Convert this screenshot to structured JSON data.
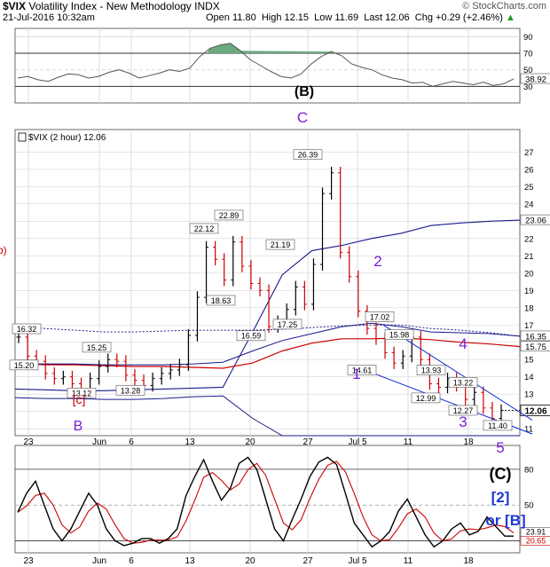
{
  "header": {
    "symbol": "$VIX",
    "name": "Volatility Index - New Methodology  INDX",
    "datetime": "21-Jul-2016 10:32am",
    "open_label": "Open",
    "open": "11.80",
    "high_label": "High",
    "high": "12.15",
    "low_label": "Low",
    "low": "11.69",
    "last_label": "Last",
    "last": "12.06",
    "chg_label": "Chg",
    "chg": "+0.29 (+2.46%)",
    "chg_arrow": "▲",
    "watermark": "© StockCharts.com"
  },
  "colors": {
    "price_up": "#000000",
    "price_down": "#cc0000",
    "bollinger": "#1a1a8c",
    "ma_red": "#cc0000",
    "ma_dotted": "#1a1a8c",
    "wave_purple": "#7a1fd6",
    "wave_red": "#cc0000",
    "wave_blue": "#1f38d6",
    "rsi_fill": "#6aaa7e",
    "grid": "#d6d6d6"
  },
  "chart_data": [
    {
      "type": "line",
      "panel": "RSI",
      "ylim": [
        10,
        100
      ],
      "yticks": [
        30,
        50,
        70,
        90
      ],
      "overbought": 70,
      "oversold": 30,
      "last_value": "38.92",
      "annotation": "(B)",
      "values": [
        40,
        42,
        38,
        36,
        41,
        45,
        44,
        40,
        42,
        47,
        50,
        46,
        40,
        43,
        46,
        50,
        48,
        52,
        66,
        76,
        80,
        82,
        73,
        62,
        55,
        48,
        42,
        40,
        45,
        57,
        66,
        72,
        67,
        57,
        53,
        50,
        44,
        40,
        38,
        34,
        35,
        30,
        33,
        36,
        34,
        32,
        35,
        31,
        33,
        39
      ]
    },
    {
      "type": "line",
      "panel": "price",
      "legend": "$VIX (2 hour) 12.06",
      "last_value": "12.06",
      "ylim": [
        10.6,
        28.3
      ],
      "yticks": [
        11,
        12,
        13,
        14,
        15,
        16,
        17,
        18,
        19,
        20,
        21,
        22,
        23,
        24,
        25,
        26,
        27
      ],
      "xlabels": [
        "23",
        "Jun",
        "6",
        "13",
        "20",
        "27",
        "Jul 5",
        "11",
        "18"
      ],
      "closes": [
        16.3,
        15.2,
        14.9,
        14.2,
        13.9,
        14.0,
        13.6,
        13.3,
        13.9,
        14.6,
        15.0,
        14.9,
        14.1,
        13.8,
        13.5,
        13.9,
        14.2,
        14.4,
        14.7,
        16.4,
        18.6,
        21.5,
        20.8,
        19.6,
        21.8,
        20.4,
        19.4,
        19.0,
        16.9,
        17.2,
        17.9,
        19.2,
        18.2,
        20.5,
        24.6,
        25.8,
        21.2,
        19.8,
        17.8,
        16.8,
        16.2,
        15.4,
        14.8,
        15.2,
        16.3,
        15.0,
        13.6,
        13.4,
        13.9,
        13.5,
        12.7,
        13.1,
        12.2,
        11.6,
        12.06
      ],
      "price_labels": [
        "16.32",
        "15.20",
        "15.25",
        "13.12",
        "13.28",
        "22.12",
        "22.89",
        "18.63",
        "21.19",
        "16.59",
        "17.25",
        "26.39",
        "17.02",
        "15.98",
        "14.61",
        "13.93",
        "13.22",
        "12.99",
        "12.27",
        "11.40"
      ],
      "overlays": [
        {
          "name": "23.06",
          "values": [
            13.3,
            13.25,
            13.2,
            13.2,
            13.25,
            13.3,
            13.35,
            13.4,
            16.6,
            19.9,
            21.3,
            21.6,
            22.0,
            22.3,
            22.75,
            22.9,
            23.0,
            23.06
          ]
        },
        {
          "name": "16.35",
          "values": [
            16.95,
            16.8,
            16.7,
            16.6,
            16.6,
            16.65,
            16.7,
            16.7,
            16.7,
            16.75,
            16.85,
            16.95,
            17.0,
            17.0,
            16.8,
            16.7,
            16.55,
            16.35
          ]
        },
        {
          "name": "15.75",
          "values": [
            14.8,
            14.7,
            14.7,
            14.65,
            14.6,
            14.6,
            14.55,
            14.5,
            14.8,
            15.5,
            15.95,
            16.2,
            16.2,
            16.25,
            16.15,
            16.0,
            15.9,
            15.75
          ]
        },
        {
          "values": [
            14.75,
            14.75,
            14.75,
            14.7,
            14.7,
            14.7,
            14.75,
            14.85,
            15.5,
            16.1,
            16.5,
            16.9,
            17.1,
            16.9,
            16.6,
            16.55,
            16.5,
            16.35
          ]
        },
        {
          "values": [
            12.8,
            12.75,
            12.75,
            12.7,
            12.7,
            12.75,
            12.85,
            12.9,
            11.6,
            10.6,
            10.6,
            10.6,
            10.6,
            10.6,
            10.6,
            10.6,
            10.6,
            10.6
          ]
        }
      ],
      "wave_labels": [
        "[c]",
        "B",
        "C",
        "1",
        "2",
        "3",
        "4",
        "5"
      ]
    },
    {
      "type": "line",
      "panel": "stochastic",
      "ylim": [
        10,
        100
      ],
      "yticks": [
        20,
        50,
        80
      ],
      "last_value_1": "23.91",
      "last_value_2": "20.65",
      "annotation_1": "(C)",
      "annotation_2": "[2]",
      "annotation_3": "or [B]",
      "values": [
        44,
        60,
        70,
        50,
        30,
        20,
        30,
        45,
        60,
        50,
        30,
        20,
        16,
        18,
        22,
        22,
        18,
        22,
        30,
        58,
        74,
        88,
        70,
        54,
        64,
        85,
        90,
        80,
        55,
        30,
        20,
        38,
        55,
        74,
        86,
        90,
        84,
        60,
        35,
        25,
        15,
        20,
        28,
        45,
        55,
        40,
        25,
        15,
        20,
        30,
        35,
        25,
        28,
        40,
        32,
        24,
        24
      ]
    }
  ]
}
